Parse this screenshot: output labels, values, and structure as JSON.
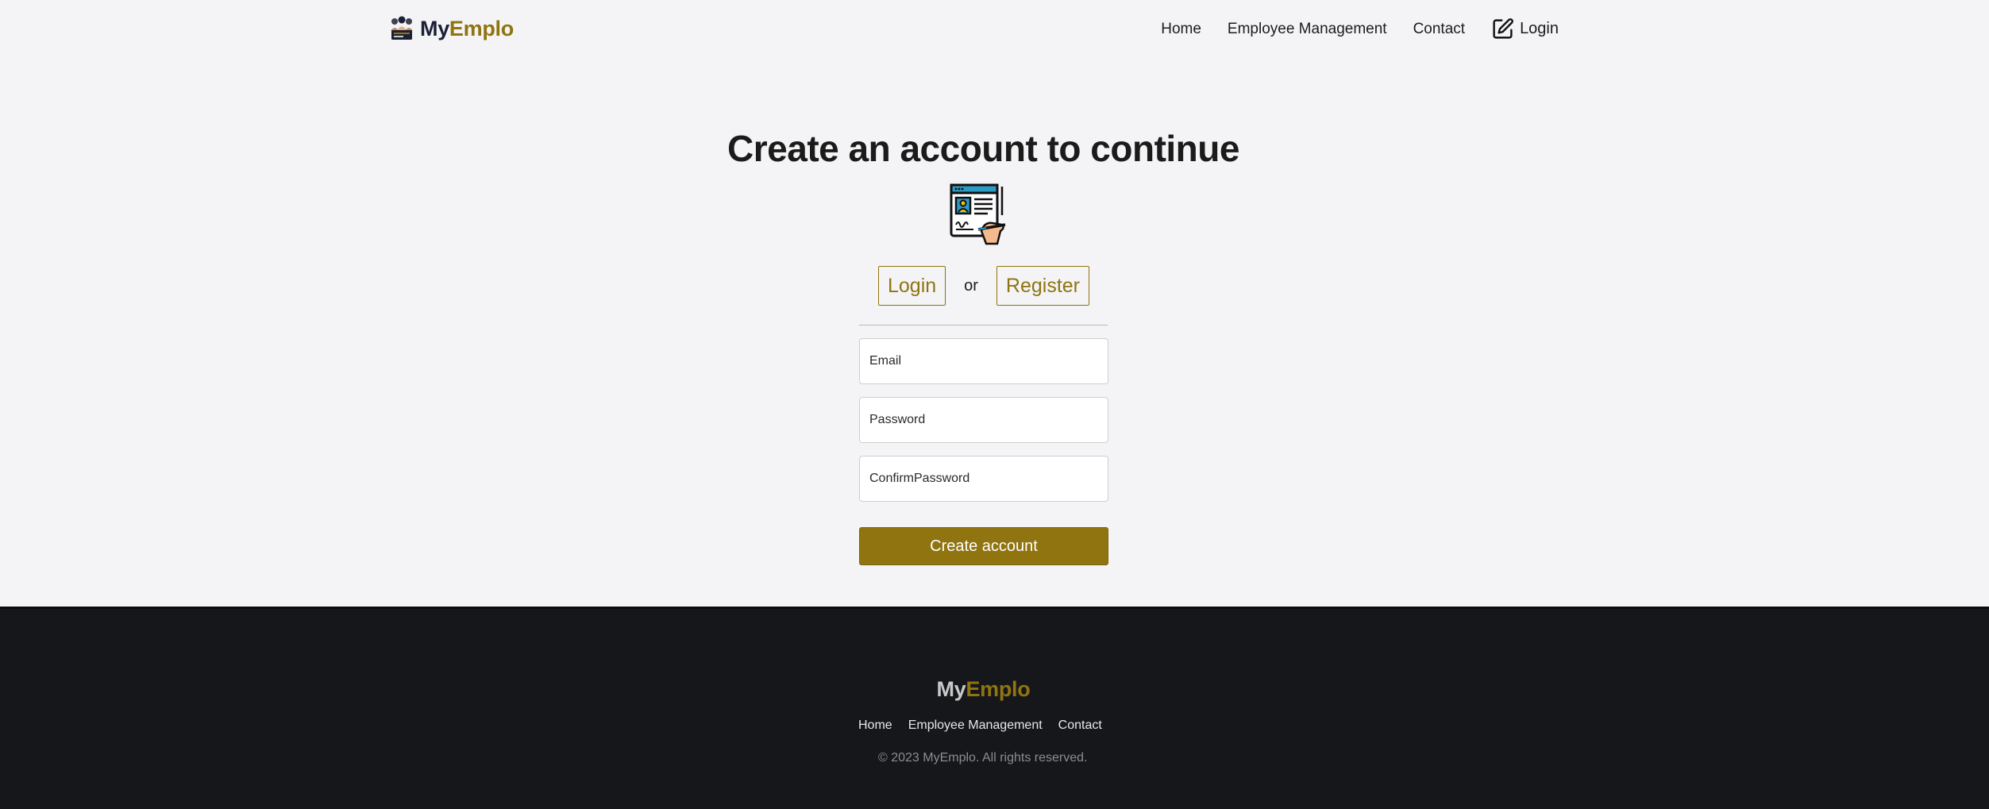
{
  "header": {
    "brand": {
      "part1": "My",
      "part2": "Emplo",
      "logo_icon": "team-logo-icon"
    },
    "nav": {
      "home": "Home",
      "employee_management": "Employee Management",
      "contact": "Contact",
      "login": "Login",
      "login_icon": "edit-square-icon"
    }
  },
  "main": {
    "title": "Create an account to continue",
    "illustration_icon": "signing-document-icon",
    "switch": {
      "login": "Login",
      "or": "or",
      "register": "Register"
    },
    "form": {
      "email_placeholder": "Email",
      "password_placeholder": "Password",
      "confirm_placeholder": "ConfirmPassword",
      "submit": "Create account"
    }
  },
  "footer": {
    "brand": {
      "part1": "My",
      "part2": "Emplo"
    },
    "links": {
      "home": "Home",
      "employee_management": "Employee Management",
      "contact": "Contact"
    },
    "copyright": "© 2023 MyEmplo. All rights reserved."
  },
  "colors": {
    "accent": "#8f7410",
    "background": "#f4f4f6",
    "footer_background": "#16171b",
    "brand_dark": "#1b2036"
  }
}
